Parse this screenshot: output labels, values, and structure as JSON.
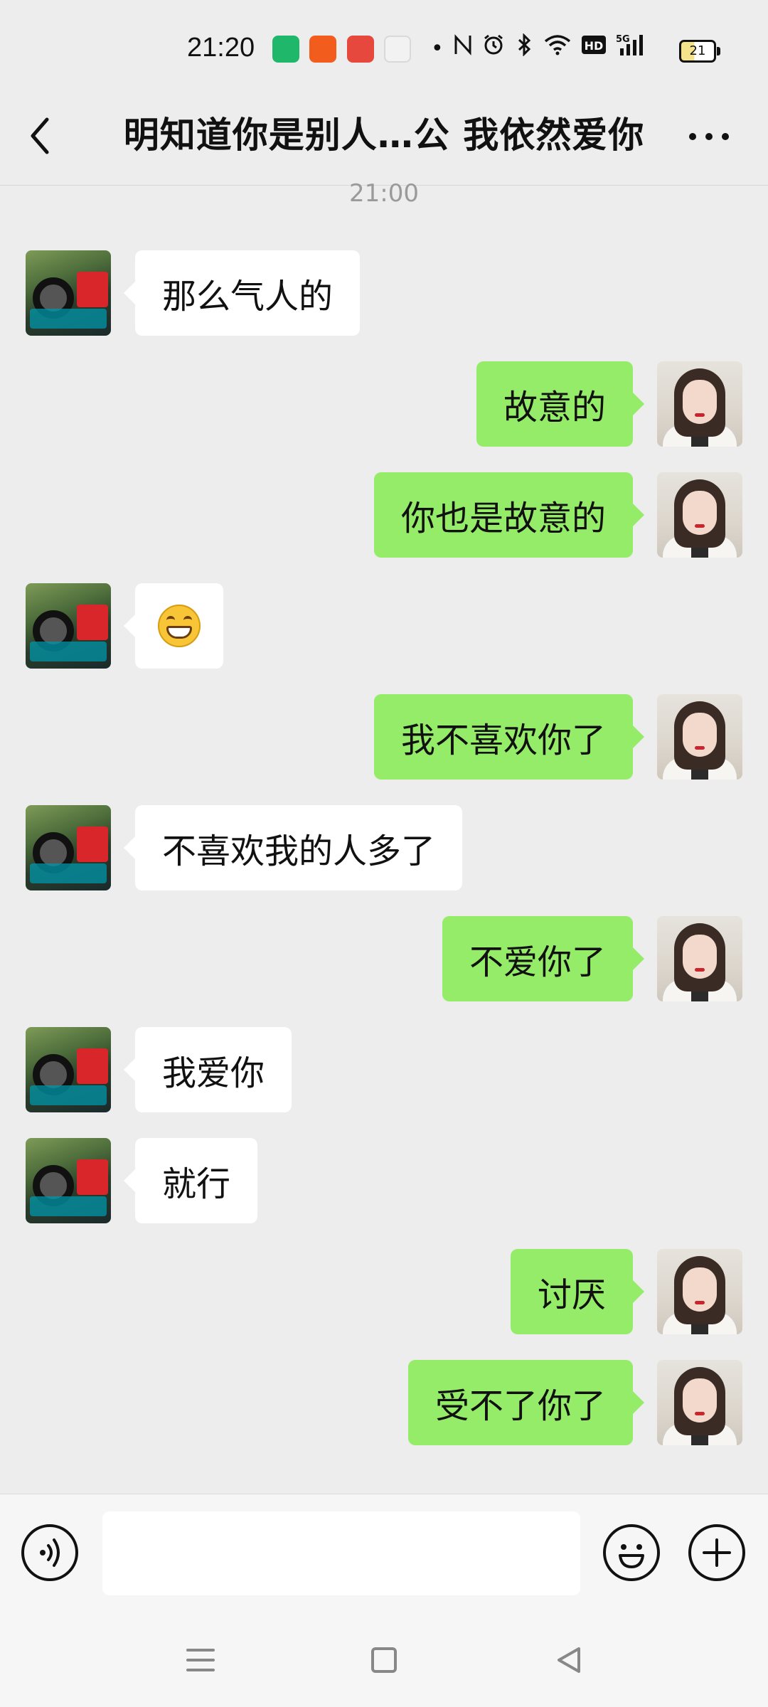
{
  "status_bar": {
    "time": "21:20",
    "app_icons": [
      "wechat-mini-icon",
      "taobao-icon",
      "video-play-icon",
      "podcast-icon"
    ],
    "indicators": [
      "dot-icon",
      "nfc-icon",
      "alarm-icon",
      "bluetooth-icon",
      "wifi-icon",
      "hd-icon",
      "5g-signal-icon"
    ],
    "battery": "21"
  },
  "header": {
    "title": "明知道你是别人…公 我依然爱你",
    "back_icon": "chevron-left-icon",
    "more_icon": "more-horizontal-icon"
  },
  "chat": {
    "timestamp": "21:00",
    "messages": [
      {
        "side": "left",
        "text": "那么气人的"
      },
      {
        "side": "right",
        "text": "故意的"
      },
      {
        "side": "right",
        "text": "你也是故意的"
      },
      {
        "side": "left",
        "emoji": "grinning-face-emoji"
      },
      {
        "side": "right",
        "text": "我不喜欢你了"
      },
      {
        "side": "left",
        "text": "不喜欢我的人多了"
      },
      {
        "side": "right",
        "text": "不爱你了"
      },
      {
        "side": "left",
        "text": "我爱你"
      },
      {
        "side": "left",
        "text": "就行"
      },
      {
        "side": "right",
        "text": "讨厌"
      },
      {
        "side": "right",
        "text": "受不了你了"
      }
    ]
  },
  "input_bar": {
    "value": "",
    "voice_icon": "voice-icon",
    "emoji_icon": "smiley-icon",
    "plus_icon": "plus-icon"
  },
  "nav_bar": {
    "icons": [
      "menu-icon",
      "home-square-icon",
      "back-triangle-icon"
    ]
  },
  "colors": {
    "background": "#ededed",
    "sent_bubble": "#95ec69",
    "received_bubble": "#ffffff"
  }
}
